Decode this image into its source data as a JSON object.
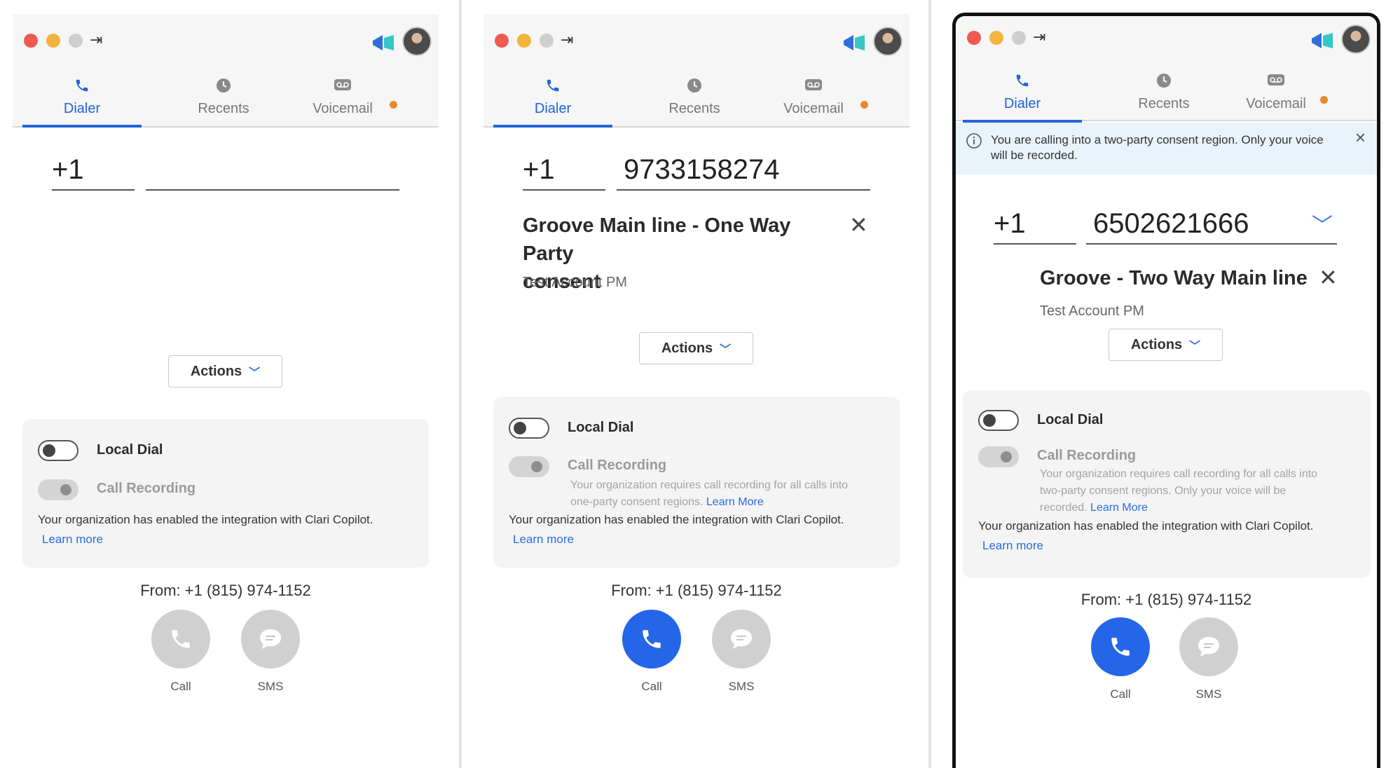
{
  "panels": [
    {
      "id": "left",
      "tabs": [
        {
          "label": "Dialer",
          "icon": "phone-icon",
          "active": true
        },
        {
          "label": "Recents",
          "icon": "clock-icon",
          "active": false
        },
        {
          "label": "Voicemail",
          "icon": "voicemail-icon",
          "active": false,
          "badge": true
        }
      ],
      "country_code": "+1",
      "phone_number": "",
      "actions_label": "Actions",
      "local_dial_label": "Local Dial",
      "call_recording_label": "Call Recording",
      "org_note": "Your organization has enabled the integration with Clari Copilot.",
      "learn_more": "Learn more",
      "from": "From: +1 (815) 974-1152",
      "call_label": "Call",
      "sms_label": "SMS",
      "call_button_state": "disabled"
    },
    {
      "id": "middle",
      "tabs": [
        {
          "label": "Dialer",
          "icon": "phone-icon",
          "active": true
        },
        {
          "label": "Recents",
          "icon": "clock-icon",
          "active": false
        },
        {
          "label": "Voicemail",
          "icon": "voicemail-icon",
          "active": false,
          "badge": true
        }
      ],
      "country_code": "+1",
      "phone_number": "9733158274",
      "contact_name_line1": "Groove Main line - One Way Party",
      "contact_name_line2": "consent",
      "account": "Test Account PM",
      "actions_label": "Actions",
      "local_dial_label": "Local Dial",
      "call_recording_label": "Call Recording",
      "recording_note_line1": "Your organization requires call recording for all calls into",
      "recording_note_line2": "one-party consent regions.",
      "recording_learn_more": "Learn More",
      "org_note": "Your organization has enabled the integration with Clari Copilot.",
      "learn_more": "Learn more",
      "from": "From: +1 (815) 974-1152",
      "call_label": "Call",
      "sms_label": "SMS",
      "call_button_state": "enabled"
    },
    {
      "id": "right",
      "tabs": [
        {
          "label": "Dialer",
          "icon": "phone-icon",
          "active": true
        },
        {
          "label": "Recents",
          "icon": "clock-icon",
          "active": false
        },
        {
          "label": "Voicemail",
          "icon": "voicemail-icon",
          "active": false,
          "badge": true
        }
      ],
      "banner_line1": "You are calling into a two-party consent region. Only your voice",
      "banner_line2": "will be recorded.",
      "country_code": "+1",
      "phone_number": "6502621666",
      "contact_name": "Groove - Two Way Main line",
      "account": "Test Account PM",
      "actions_label": "Actions",
      "local_dial_label": "Local Dial",
      "call_recording_label": "Call Recording",
      "recording_note_line1": "Your organization requires call recording for all calls into",
      "recording_note_line2": "two-party consent regions. Only your voice will be",
      "recording_note_line3": "recorded.",
      "recording_learn_more": "Learn More",
      "org_note": "Your organization has enabled the integration with Clari Copilot.",
      "learn_more": "Learn more",
      "from": "From: +1 (815) 974-1152",
      "call_label": "Call",
      "sms_label": "SMS",
      "call_button_state": "enabled"
    }
  ],
  "colors": {
    "accent": "#2563d9",
    "call_enabled": "#2566e8",
    "call_disabled": "#d0d0d0",
    "badge": "#e8892b",
    "banner_bg": "#e8f3fb"
  }
}
